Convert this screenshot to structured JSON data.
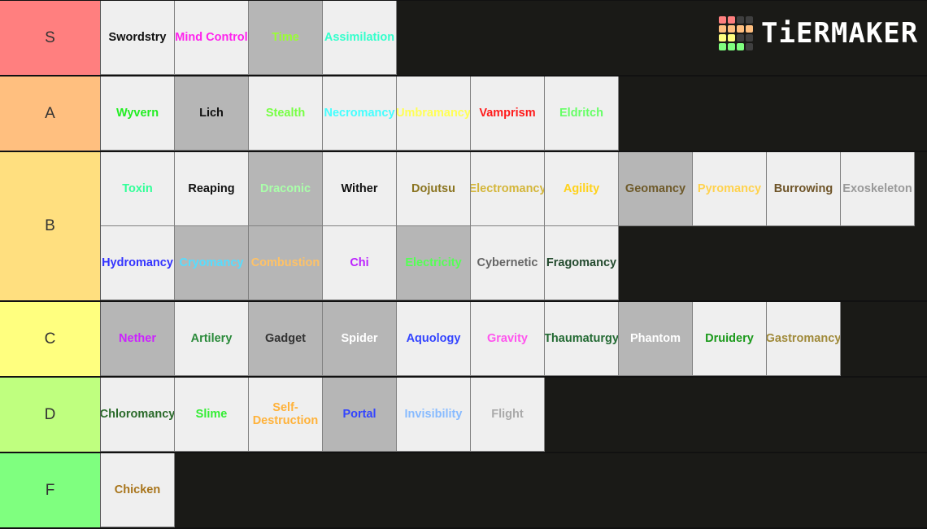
{
  "app": {
    "logo_text": "TiERMAKER",
    "logo_grid_colors": [
      "#ff7f7f",
      "#ff7f7f",
      "#3f3f3f",
      "#3f3f3f",
      "#ffbf7f",
      "#ffbf7f",
      "#ffbf7f",
      "#ffbf7f",
      "#ffff7f",
      "#ffff7f",
      "#3f3f3f",
      "#3f3f3f",
      "#7fff7f",
      "#7fff7f",
      "#7fff7f",
      "#3f3f3f"
    ]
  },
  "tiers": [
    {
      "label": "S",
      "color": "#ff7f7f",
      "items": [
        {
          "name": "Swordstry",
          "color": "#111111",
          "bg": "light"
        },
        {
          "name": "Mind Control",
          "color": "#ff22ee",
          "bg": "light",
          "wrap": true
        },
        {
          "name": "Time",
          "color": "#99ff33",
          "bg": "gray"
        },
        {
          "name": "Assimilation",
          "color": "#33ffcc",
          "bg": "light"
        }
      ]
    },
    {
      "label": "A",
      "color": "#ffbf7f",
      "items": [
        {
          "name": "Wyvern",
          "color": "#22ee22",
          "bg": "light"
        },
        {
          "name": "Lich",
          "color": "#111111",
          "bg": "gray"
        },
        {
          "name": "Stealth",
          "color": "#77ff44",
          "bg": "light"
        },
        {
          "name": "Necromancy",
          "color": "#44ffff",
          "bg": "light"
        },
        {
          "name": "Umbramancy",
          "color": "#ffff55",
          "bg": "light"
        },
        {
          "name": "Vamprism",
          "color": "#ff1a1a",
          "bg": "light"
        },
        {
          "name": "Eldritch",
          "color": "#66ff66",
          "bg": "light"
        }
      ]
    },
    {
      "label": "B",
      "color": "#ffdf7f",
      "items": [
        {
          "name": "Toxin",
          "color": "#33ff99",
          "bg": "light"
        },
        {
          "name": "Reaping",
          "color": "#111111",
          "bg": "light"
        },
        {
          "name": "Draconic",
          "color": "#aaffaa",
          "bg": "gray"
        },
        {
          "name": "Wither",
          "color": "#111111",
          "bg": "light"
        },
        {
          "name": "Dojutsu",
          "color": "#8a7420",
          "bg": "light"
        },
        {
          "name": "Electromancy",
          "color": "#d4b63a",
          "bg": "light"
        },
        {
          "name": "Agility",
          "color": "#ffd21a",
          "bg": "light"
        },
        {
          "name": "Geomancy",
          "color": "#6e5a2a",
          "bg": "gray"
        },
        {
          "name": "Pyromancy",
          "color": "#ffd24d",
          "bg": "light"
        },
        {
          "name": "Burrowing",
          "color": "#6e5428",
          "bg": "light"
        },
        {
          "name": "Exoskeleton",
          "color": "#999999",
          "bg": "light"
        },
        {
          "name": "Hydromancy",
          "color": "#3333ff",
          "bg": "light"
        },
        {
          "name": "Cryomancy",
          "color": "#55ddff",
          "bg": "gray"
        },
        {
          "name": "Combustion",
          "color": "#ffc266",
          "bg": "gray"
        },
        {
          "name": "Chi",
          "color": "#bb22ff",
          "bg": "light"
        },
        {
          "name": "Electricity",
          "color": "#55ff55",
          "bg": "gray"
        },
        {
          "name": "Cybernetic",
          "color": "#666666",
          "bg": "light"
        },
        {
          "name": "Fragomancy",
          "color": "#234a2e",
          "bg": "light"
        }
      ]
    },
    {
      "label": "C",
      "color": "#ffff7f",
      "items": [
        {
          "name": "Nether",
          "color": "#cc22ff",
          "bg": "gray"
        },
        {
          "name": "Artilery",
          "color": "#2a8a3a",
          "bg": "light"
        },
        {
          "name": "Gadget",
          "color": "#333333",
          "bg": "gray"
        },
        {
          "name": "Spider",
          "color": "#ffffff",
          "bg": "gray"
        },
        {
          "name": "Aquology",
          "color": "#3344ff",
          "bg": "light"
        },
        {
          "name": "Gravity",
          "color": "#ff55ee",
          "bg": "light"
        },
        {
          "name": "Thaumaturgy",
          "color": "#236a33",
          "bg": "light"
        },
        {
          "name": "Phantom",
          "color": "#ffffff",
          "bg": "gray"
        },
        {
          "name": "Druidery",
          "color": "#1a991a",
          "bg": "light"
        },
        {
          "name": "Gastromancy",
          "color": "#a08a3a",
          "bg": "light"
        }
      ]
    },
    {
      "label": "D",
      "color": "#bfff7f",
      "items": [
        {
          "name": "Chloromancy",
          "color": "#2a6a2a",
          "bg": "light"
        },
        {
          "name": "Slime",
          "color": "#33ee33",
          "bg": "light"
        },
        {
          "name": "Self-Destruction",
          "color": "#ffb23a",
          "bg": "light",
          "wrap": true
        },
        {
          "name": "Portal",
          "color": "#3344ff",
          "bg": "gray"
        },
        {
          "name": "Invisibility",
          "color": "#88bbff",
          "bg": "light"
        },
        {
          "name": "Flight",
          "color": "#aaaaaa",
          "bg": "light"
        }
      ]
    },
    {
      "label": "F",
      "color": "#7fff7f",
      "items": [
        {
          "name": "Chicken",
          "color": "#a8741a",
          "bg": "light"
        }
      ]
    }
  ]
}
